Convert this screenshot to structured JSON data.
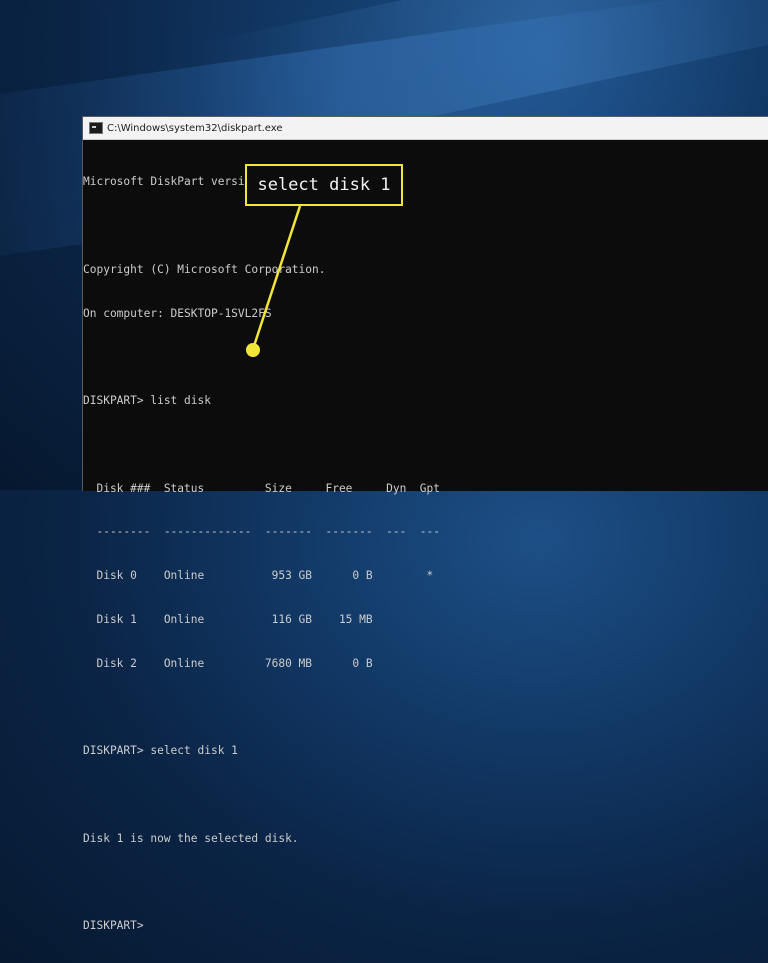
{
  "window": {
    "title": "C:\\Windows\\system32\\diskpart.exe"
  },
  "console": {
    "lines": [
      "Microsoft DiskPart version 10.0.22000.653",
      "",
      "Copyright (C) Microsoft Corporation.",
      "On computer: DESKTOP-1SVL2FS",
      "",
      "DISKPART> list disk",
      "",
      "  Disk ###  Status         Size     Free     Dyn  Gpt",
      "  --------  -------------  -------  -------  ---  ---",
      "  Disk 0    Online          953 GB      0 B        *",
      "  Disk 1    Online          116 GB    15 MB",
      "  Disk 2    Online         7680 MB      0 B",
      "",
      "DISKPART> select disk 1",
      "",
      "Disk 1 is now the selected disk.",
      "",
      "DISKPART>"
    ]
  },
  "annotation": {
    "callout_text": "select disk 1",
    "accent_color": "#f0e63a"
  }
}
